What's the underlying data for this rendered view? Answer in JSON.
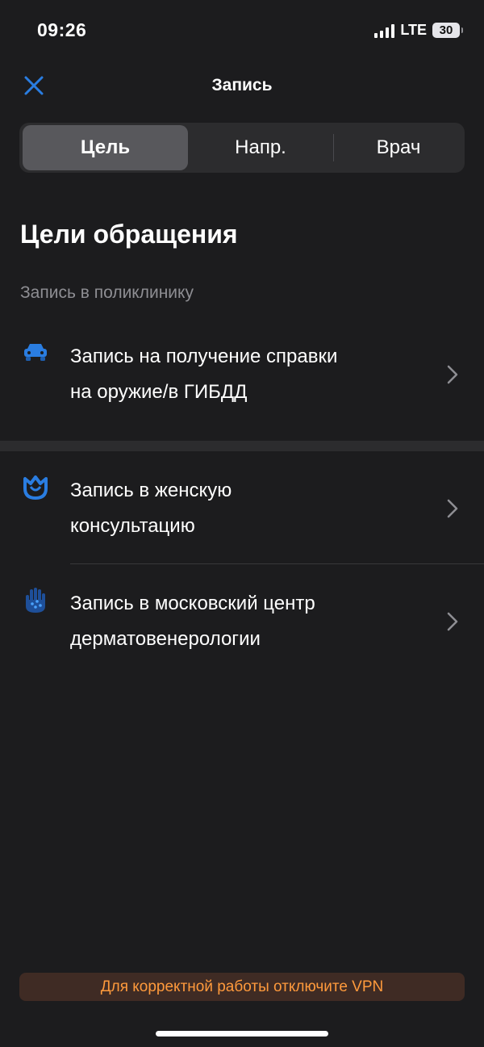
{
  "status_bar": {
    "time": "09:26",
    "network": "LTE",
    "battery": "30"
  },
  "nav": {
    "title": "Запись"
  },
  "segments": [
    {
      "label": "Цель",
      "active": true
    },
    {
      "label": "Напр.",
      "active": false
    },
    {
      "label": "Врач",
      "active": false
    }
  ],
  "page": {
    "title": "Цели обращения",
    "section_label": "Запись в поликлинику"
  },
  "items": [
    {
      "line1": "Запись на получение справки",
      "line2": "на оружие/в ГИБДД",
      "icon": "car-icon"
    },
    {
      "line1": "Запись в женскую",
      "line2": "консультацию",
      "icon": "tulip-icon"
    },
    {
      "line1": "Запись в московский центр",
      "line2": "дерматовенерологии",
      "icon": "hand-icon"
    }
  ],
  "banner": {
    "text": "Для корректной работы отключите VPN"
  },
  "colors": {
    "accent": "#2a7de1",
    "background": "#1c1c1e",
    "warning": "#ff9a3c"
  }
}
